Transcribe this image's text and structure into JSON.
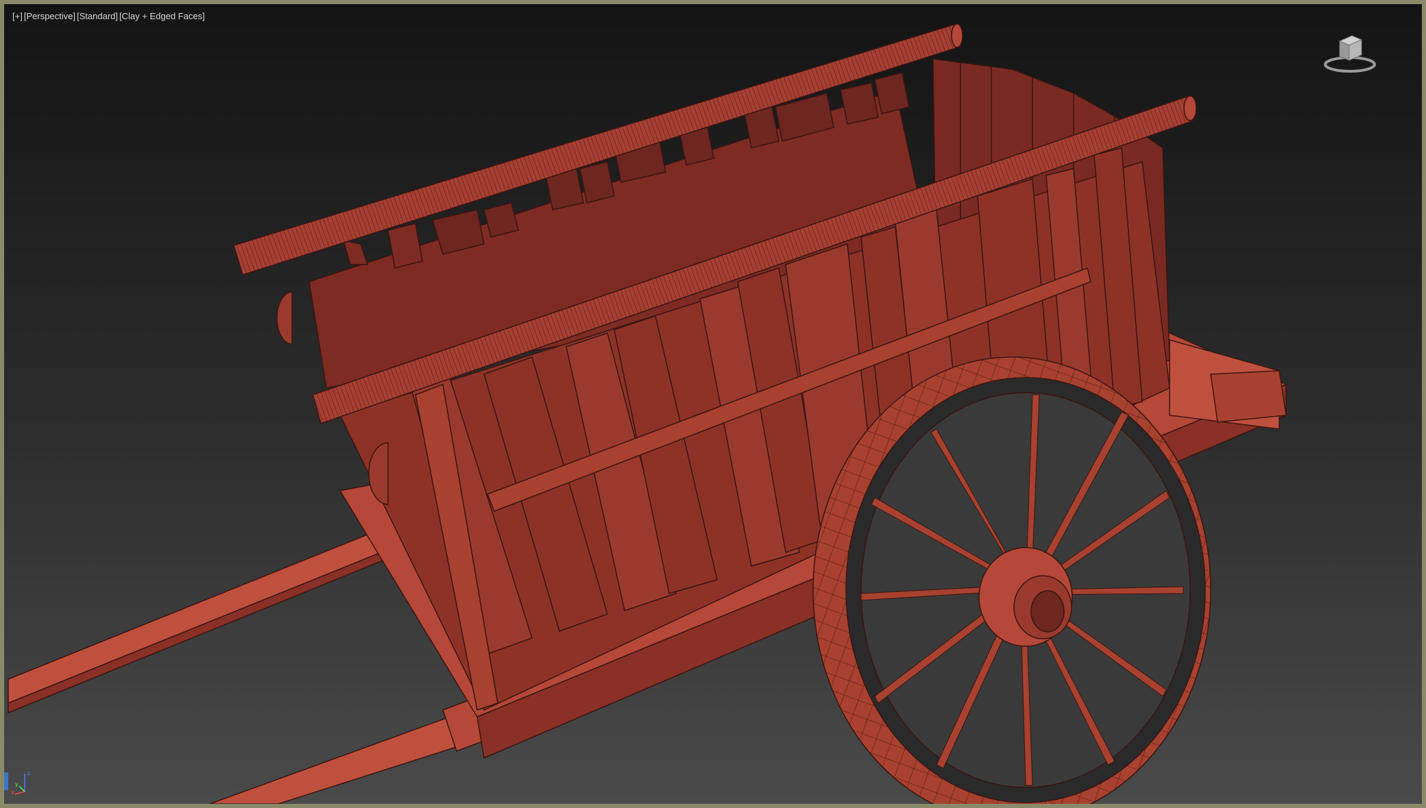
{
  "viewport": {
    "labels": {
      "plus": "+",
      "view": "Perspective",
      "shading_preset": "Standard",
      "display_mode": "Clay + Edged Faces"
    },
    "viewcube_icon": "viewcube-gizmo",
    "axis_icon": "xyz-axis-tripod",
    "axis_letters": {
      "x": "x",
      "y": "y",
      "z": "z"
    },
    "colors": {
      "border": "#8a8a6a",
      "clay": "#b4493b",
      "clay_dark": "#7a2a22",
      "edges": "#3a1511",
      "bg_top": "#141414",
      "bg_bottom": "#4a4a4a"
    }
  }
}
